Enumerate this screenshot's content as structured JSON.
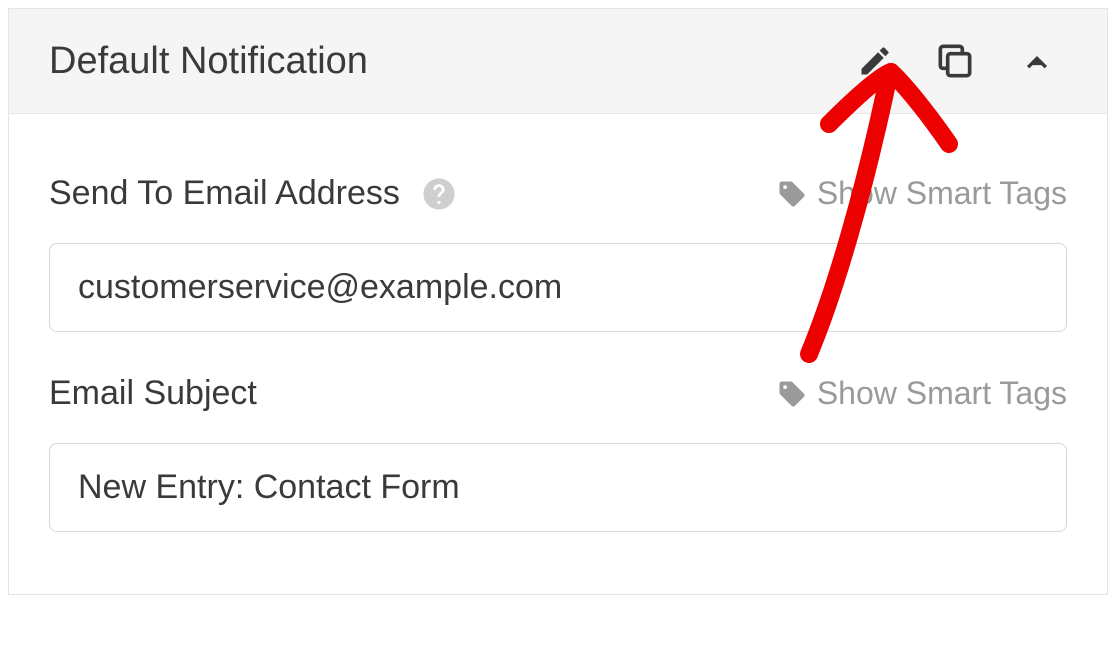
{
  "panel": {
    "title": "Default Notification"
  },
  "fields": {
    "sendTo": {
      "label": "Send To Email Address",
      "value": "customerservice@example.com",
      "smartTags": "Show Smart Tags"
    },
    "subject": {
      "label": "Email Subject",
      "value": "New Entry: Contact Form",
      "smartTags": "Show Smart Tags"
    }
  }
}
